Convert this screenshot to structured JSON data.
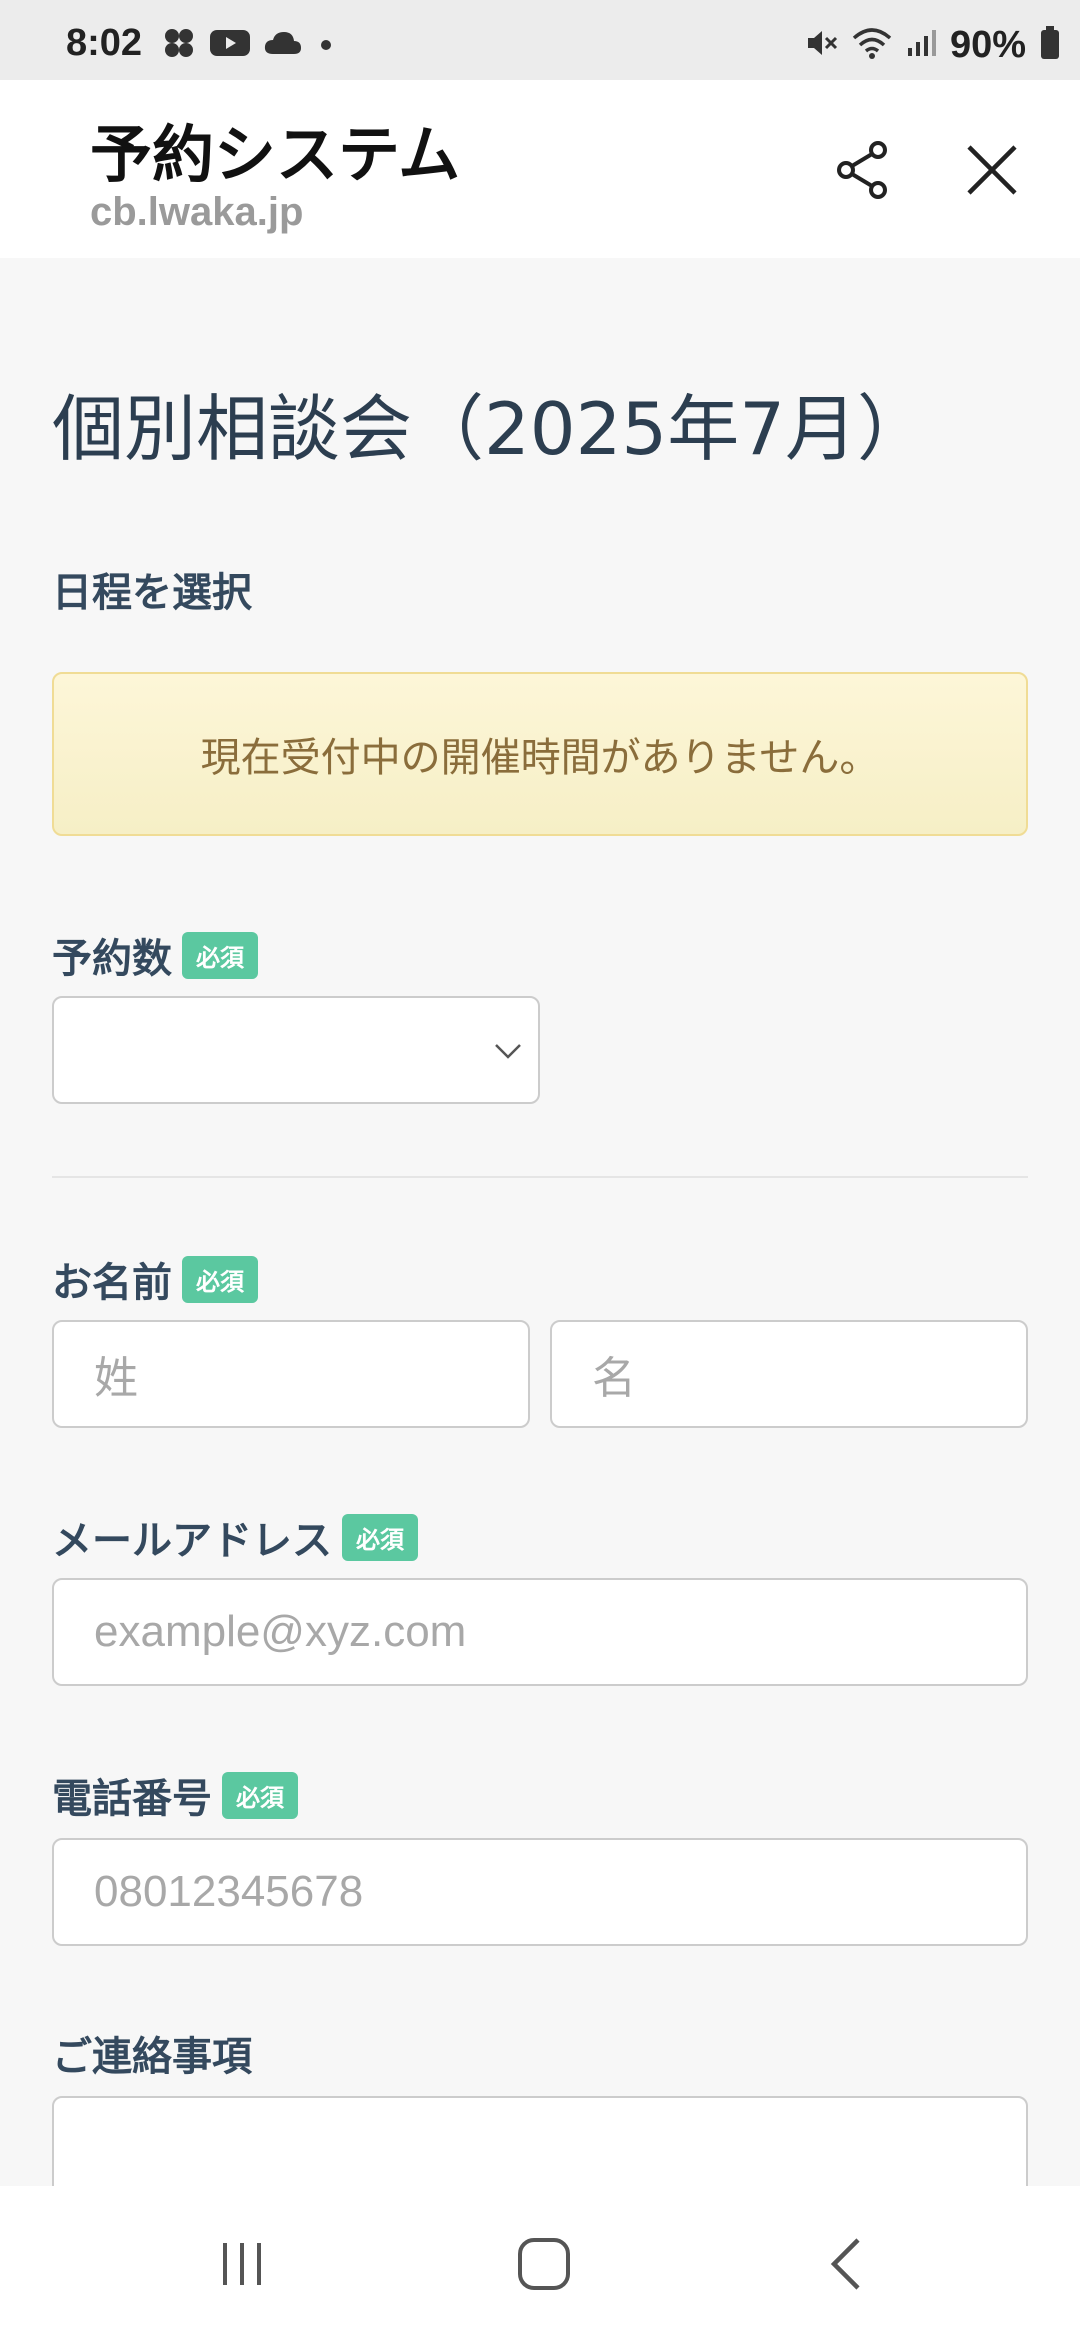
{
  "status_bar": {
    "time": "8:02",
    "battery": "90%",
    "left_icons": [
      "slack-icon",
      "youtube-icon",
      "cloud-icon",
      "dot-icon"
    ],
    "right_icons": [
      "mute-icon",
      "wifi-icon",
      "signal-icon",
      "battery-icon"
    ]
  },
  "header": {
    "title": "予約システム",
    "url": "cb.lwaka.jp"
  },
  "page": {
    "title": "個別相談会（2025年7月）"
  },
  "schedule": {
    "label": "日程を選択",
    "notice": "現在受付中の開催時間がありません。"
  },
  "required_badge": "必須",
  "fields": {
    "reservation_count": {
      "label": "予約数",
      "value": ""
    },
    "name": {
      "label": "お名前",
      "last_placeholder": "姓",
      "first_placeholder": "名"
    },
    "email": {
      "label": "メールアドレス",
      "placeholder": "example@xyz.com"
    },
    "phone": {
      "label": "電話番号",
      "placeholder": "08012345678"
    },
    "notes": {
      "label": "ご連絡事項"
    }
  },
  "colors": {
    "badge": "#5bc8a0",
    "title_text": "#2c3e50",
    "notice_bg": "#fdf6d8",
    "notice_text": "#8a6d3b"
  }
}
